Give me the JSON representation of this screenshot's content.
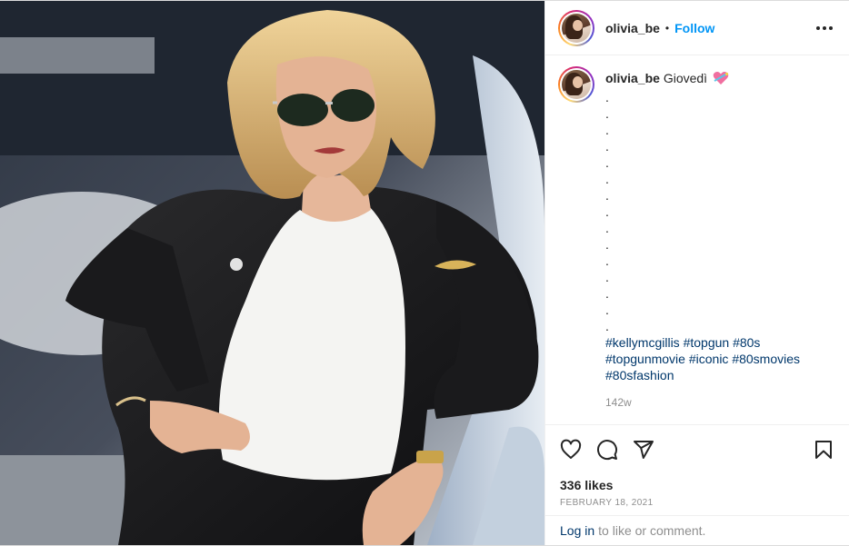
{
  "header": {
    "username": "olivia_be",
    "separator": "•",
    "follow_label": "Follow"
  },
  "caption": {
    "username": "olivia_be",
    "text": "Giovedì",
    "emoji": "heart-with-ribbon-emoji",
    "dots": [
      ".",
      ".",
      ".",
      ".",
      ".",
      ".",
      ".",
      ".",
      ".",
      ".",
      ".",
      ".",
      ".",
      ".",
      "."
    ],
    "hashtags": [
      "#kellymcgillis",
      "#topgun",
      "#80s",
      "#topgunmovie",
      "#iconic",
      "#80smovies",
      "#80sfashion"
    ],
    "time_ago": "142w"
  },
  "actions": {
    "icons": [
      "heart-icon",
      "comment-icon",
      "share-icon",
      "bookmark-icon"
    ],
    "likes": "336 likes",
    "date": "February 18, 2021"
  },
  "login": {
    "link": "Log in",
    "text": "to like or comment."
  },
  "colors": {
    "link_blue": "#0095f6",
    "hashtag": "#00376b",
    "muted": "#8e8e8e",
    "text": "#262626"
  }
}
